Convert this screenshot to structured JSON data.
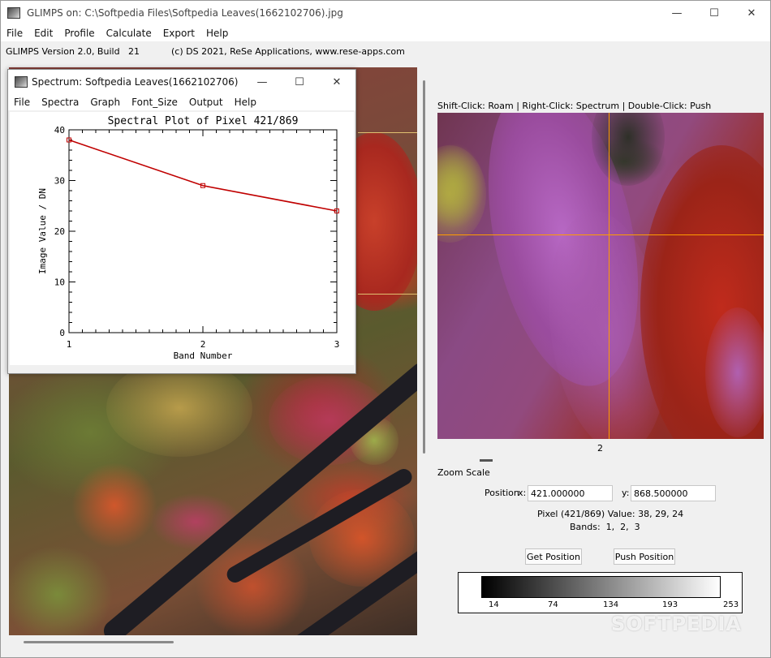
{
  "window": {
    "title": "GLIMPS on: C:\\Softpedia Files\\Softpedia Leaves(1662102706).jpg",
    "minimize_glyph": "—",
    "maximize_glyph": "☐",
    "close_glyph": "✕"
  },
  "menu": [
    "File",
    "Edit",
    "Profile",
    "Calculate",
    "Export",
    "Help"
  ],
  "info": {
    "version": "GLIMPS Version 2.0, Build   21",
    "copyright": "(c) DS 2021, ReSe Applications, www.rese-apps.com"
  },
  "spectrum_window": {
    "title": "Spectrum: Softpedia Leaves(1662102706)",
    "menu": [
      "File",
      "Spectra",
      "Graph",
      "Font_Size",
      "Output",
      "Help"
    ],
    "minimize_glyph": "—",
    "maximize_glyph": "☐",
    "close_glyph": "✕"
  },
  "chart_data": {
    "type": "line",
    "title": "Spectral Plot of Pixel 421/869",
    "xlabel": "Band Number",
    "ylabel": "Image Value / DN",
    "x": [
      1,
      2,
      3
    ],
    "series": [
      {
        "values": [
          38,
          29,
          24
        ],
        "color": "#c00000"
      }
    ],
    "xlim": [
      1,
      3
    ],
    "ylim": [
      0,
      40
    ],
    "xticks": [
      1,
      2,
      3
    ],
    "yticks": [
      0,
      10,
      20,
      30,
      40
    ],
    "grid": false
  },
  "right_panel": {
    "hint": "Shift-Click: Roam | Right-Click: Spectrum | Double-Click: Push",
    "zoom_value": "2",
    "zoom_scale_label": "Zoom Scale",
    "position_label": "Position",
    "x_label": "x:",
    "x_value": "421.000000",
    "y_label": "y:",
    "y_value": "868.500000",
    "pixel_value": "Pixel (421/869) Value: 38, 29, 24",
    "bands": "Bands:  1,  2,  3",
    "get_position": "Get Position",
    "push_position": "Push Position",
    "crosshair_color": "#ff9c00"
  },
  "colorbar": {
    "ticks": [
      "14",
      "74",
      "134",
      "193",
      "253"
    ]
  },
  "watermark": "SOFTPEDIA"
}
